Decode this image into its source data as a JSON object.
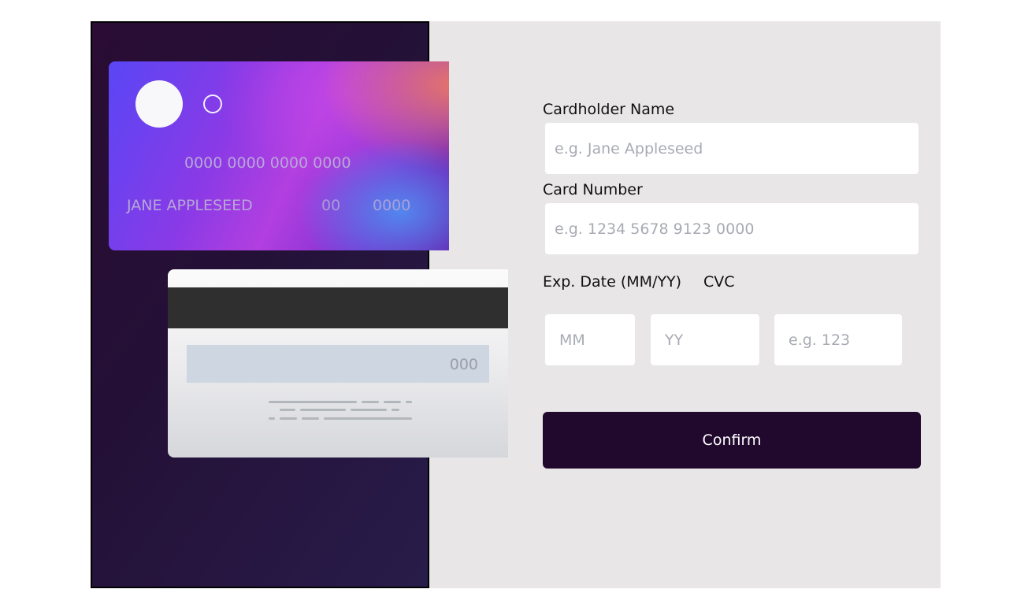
{
  "card_front": {
    "number": "0000 0000 0000 0000",
    "name": "JANE APPLESEED",
    "exp_month": "00",
    "exp_year": "0000"
  },
  "card_back": {
    "cvc": "000"
  },
  "form": {
    "cardholder_label": "Cardholder Name",
    "cardholder_placeholder": "e.g. Jane Appleseed",
    "number_label": "Card Number",
    "number_placeholder": "e.g. 1234 5678 9123 0000",
    "exp_label": "Exp. Date (MM/YY)",
    "cvc_label": "CVC",
    "mm_placeholder": "MM",
    "yy_placeholder": "YY",
    "cvc_placeholder": "e.g. 123",
    "confirm_label": "Confirm"
  }
}
